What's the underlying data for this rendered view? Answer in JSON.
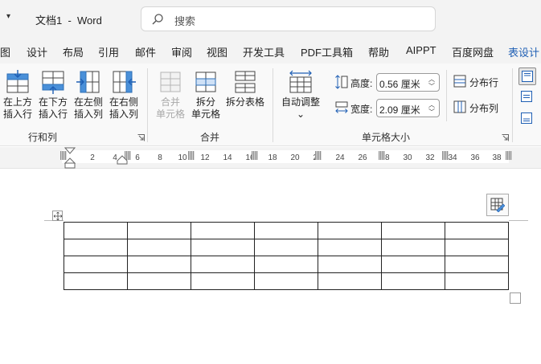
{
  "titlebar": {
    "title": "文档1  -  Word",
    "search_placeholder": "搜索",
    "dropdown_glyph": "▾"
  },
  "tabs": [
    {
      "label": "图",
      "active": false
    },
    {
      "label": "设计",
      "active": false
    },
    {
      "label": "布局",
      "active": false
    },
    {
      "label": "引用",
      "active": false
    },
    {
      "label": "邮件",
      "active": false
    },
    {
      "label": "审阅",
      "active": false
    },
    {
      "label": "视图",
      "active": false
    },
    {
      "label": "开发工具",
      "active": false
    },
    {
      "label": "PDF工具箱",
      "active": false
    },
    {
      "label": "帮助",
      "active": false
    },
    {
      "label": "AIPPT",
      "active": false
    },
    {
      "label": "百度网盘",
      "active": false
    },
    {
      "label": "表设计",
      "active": true
    }
  ],
  "ribbon": {
    "rows_cols": {
      "label": "行和列",
      "insert_above": [
        "在上方",
        "插入行"
      ],
      "insert_below": [
        "在下方",
        "插入行"
      ],
      "insert_left": [
        "在左侧",
        "插入列"
      ],
      "insert_right": [
        "在右侧",
        "插入列"
      ]
    },
    "merge": {
      "label": "合并",
      "merge_cells": [
        "合并",
        "单元格"
      ],
      "split_cells": [
        "拆分",
        "单元格"
      ],
      "split_table": "拆分表格"
    },
    "autofit": {
      "label": "自动调整",
      "caret": "⌄"
    },
    "cell_size": {
      "label": "单元格大小",
      "height_label": "高度:",
      "height_value": "0.56 厘米",
      "width_label": "宽度:",
      "width_value": "2.09 厘米",
      "distribute_rows": "分布行",
      "distribute_cols": "分布列"
    },
    "spin_up": "︿",
    "spin_down": "﹀"
  },
  "ruler": {
    "ticks": [
      "2",
      "4",
      "6",
      "8",
      "10",
      "12",
      "14",
      "16",
      "18",
      "20",
      "22",
      "24",
      "26",
      "28",
      "30",
      "32",
      "34",
      "36",
      "38"
    ]
  },
  "table": {
    "rows": 4,
    "cols": 7
  }
}
